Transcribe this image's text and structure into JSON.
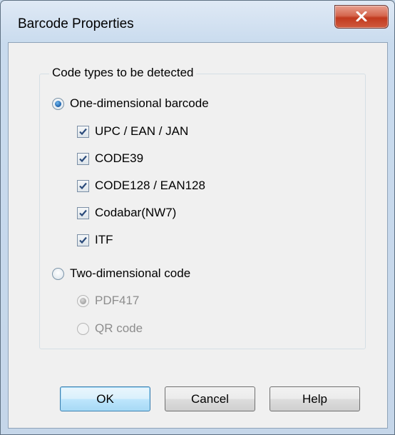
{
  "window": {
    "title": "Barcode Properties",
    "close_icon": "close-icon"
  },
  "group": {
    "legend": "Code types to be detected"
  },
  "one_dimensional": {
    "label": "One-dimensional barcode",
    "selected": true,
    "options": [
      {
        "label": "UPC / EAN / JAN",
        "checked": true
      },
      {
        "label": "CODE39",
        "checked": true
      },
      {
        "label": "CODE128 / EAN128",
        "checked": true
      },
      {
        "label": "Codabar(NW7)",
        "checked": true
      },
      {
        "label": "ITF",
        "checked": true
      }
    ]
  },
  "two_dimensional": {
    "label": "Two-dimensional code",
    "selected": false,
    "options": [
      {
        "label": "PDF417",
        "selected": true,
        "disabled": true
      },
      {
        "label": "QR code",
        "selected": false,
        "disabled": true
      }
    ]
  },
  "buttons": {
    "ok": "OK",
    "cancel": "Cancel",
    "help": "Help"
  }
}
